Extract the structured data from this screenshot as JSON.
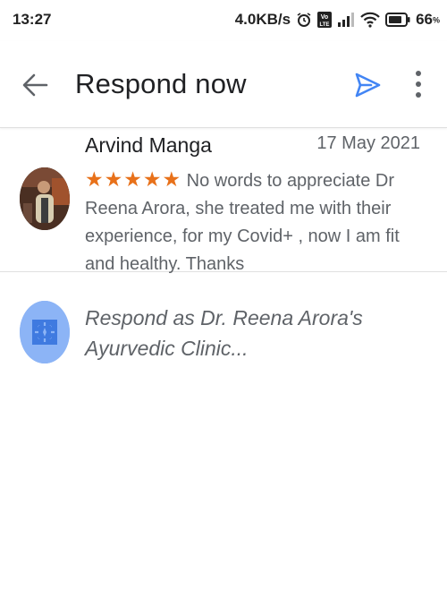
{
  "status_bar": {
    "time": "13:27",
    "net_speed": "4.0KB/s",
    "volte": "Vo LTE",
    "battery_percent": "66"
  },
  "app_bar": {
    "title": "Respond now",
    "back_icon": "arrow-back-icon",
    "send_icon": "send-icon",
    "more_icon": "more-vert-icon"
  },
  "review": {
    "reviewer_name": "Arvind Manga",
    "date": "17 May 2021",
    "stars": "★★★★★",
    "rating": 5,
    "text": "No words to appreciate Dr Reena Arora, she treated me with their experience, for my Covid+ , now I am fit and healthy. Thanks"
  },
  "respond": {
    "placeholder": "Respond as Dr. Reena Arora's Ayurvedic Clinic..."
  },
  "colors": {
    "accent_blue": "#4285f4",
    "star_orange": "#e8711a",
    "text_secondary": "#5f6368",
    "icon_light_blue": "#8cb4f6"
  }
}
